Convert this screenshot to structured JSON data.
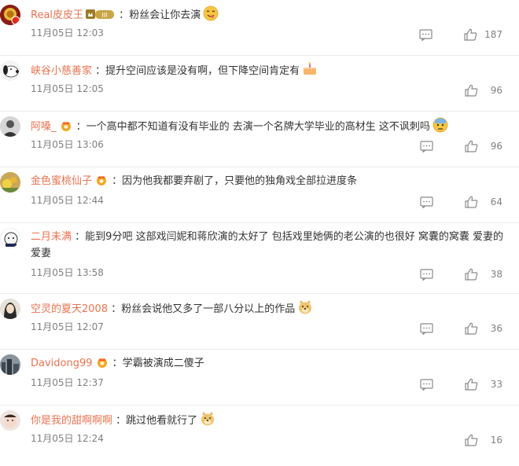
{
  "colors": {
    "username": "#eb7350",
    "text": "#333333",
    "meta": "#808080"
  },
  "comments": [
    {
      "username": "Real皮皮王",
      "badge": "III",
      "text": "粉丝会让你去演",
      "time": "11月05日 12:03",
      "likes": "187",
      "avatar_icon": "gold-crest-avatar",
      "emoji": "yum-face"
    },
    {
      "username": "峡谷小慈善家",
      "text": "提升空间应该是没有啊，但下降空间肯定有",
      "time": "11月05日 12:05",
      "likes": "96",
      "avatar_icon": "snoopy-avatar",
      "emoji": "cake"
    },
    {
      "username": "阿嗓_",
      "text": "一个高中都不知道有没有毕业的 去演一个名牌大学毕业的高材生 这不讽刺吗",
      "time": "11月05日 13:06",
      "likes": "96",
      "avatar_icon": "person-avatar",
      "emoji": "dizzy-face"
    },
    {
      "username": "金色蜜桃仙子",
      "text": "因为他我都要弃剧了，只要他的独角戏全部拉进度条",
      "time": "11月05日 12:44",
      "likes": "64",
      "avatar_icon": "flower-avatar"
    },
    {
      "username": "二月未满",
      "text": "能到9分吧 这部戏闫妮和蒋欣演的太好了 包括戏里她俩的老公演的也很好 窝囊的窝囊 爱妻的爱妻",
      "time": "11月05日 13:58",
      "likes": "38",
      "avatar_icon": "cat-avatar"
    },
    {
      "username": "空灵的夏天2008",
      "text": "粉丝会说他又多了一部八分以上的作品",
      "time": "11月05日 12:07",
      "likes": "36",
      "avatar_icon": "girl-avatar",
      "emoji": "doge"
    },
    {
      "username": "Davidong99",
      "text": "学霸被演成二傻子",
      "time": "11月05日 12:37",
      "likes": "33",
      "avatar_icon": "city-avatar"
    },
    {
      "username": "你是我的甜啊啊啊",
      "text": "跳过他看就行了",
      "time": "11月05日 12:24",
      "likes": "16",
      "avatar_icon": "baby-avatar",
      "emoji": "doge"
    }
  ]
}
